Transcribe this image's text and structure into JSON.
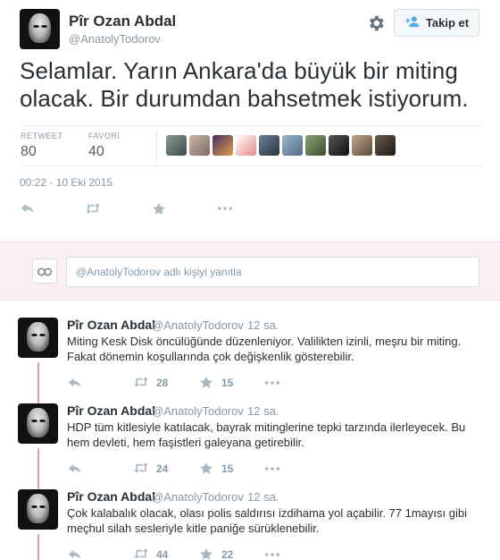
{
  "author": {
    "name": "Pîr Ozan Abdal",
    "handle": "@AnatolyTodorov"
  },
  "follow_button": {
    "label": "Takip et",
    "icon": "add-user-icon"
  },
  "settings_icon": "gear-icon",
  "tweet": {
    "text": "Selamlar. Yarın Ankara'da büyük bir miting olacak. Bir durumdan bahsetmek istiyorum.",
    "stats": {
      "retweet_label": "RETWEET",
      "retweet_count": "80",
      "favorite_label": "FAVORİ",
      "favorite_count": "40"
    },
    "favoriters_count_shown": 10,
    "timestamp": "00:22 - 10 Eki 2015"
  },
  "reply_box": {
    "mention": "@AnatolyTodorov",
    "placeholder": " adlı kişiyi yanıtla"
  },
  "replies": [
    {
      "name": "Pîr Ozan Abdal",
      "handle": "@AnatolyTodorov",
      "time": "12 sa.",
      "text": "Miting Kesk Disk öncülüğünde düzenleniyor. Valilikten izinli, meşru bir miting. Fakat dönemin koşullarında çok değişkenlik gösterebilir.",
      "retweets": "28",
      "favorites": "15"
    },
    {
      "name": "Pîr Ozan Abdal",
      "handle": "@AnatolyTodorov",
      "time": "12 sa.",
      "text": "HDP tüm kitlesiyle katılacak, bayrak mitinglerine tepki tarzında ilerleyecek. Bu hem devleti, hem faşistleri galeyana getirebilir.",
      "retweets": "24",
      "favorites": "15"
    },
    {
      "name": "Pîr Ozan Abdal",
      "handle": "@AnatolyTodorov",
      "time": "12 sa.",
      "text": "Çok kalabalık olacak, olası polis saldırısı izdihama yol açabilir. 77 1mayısı gibi meçhul silah sesleriyle kitle paniğe sürüklenebilir.",
      "retweets": "44",
      "favorites": "22"
    }
  ],
  "colors": {
    "text": "#292f33",
    "muted": "#8899a6",
    "reply_bg": "#fbeef2",
    "thread_line": "#e09aa8",
    "icon": "#aab8c2"
  }
}
